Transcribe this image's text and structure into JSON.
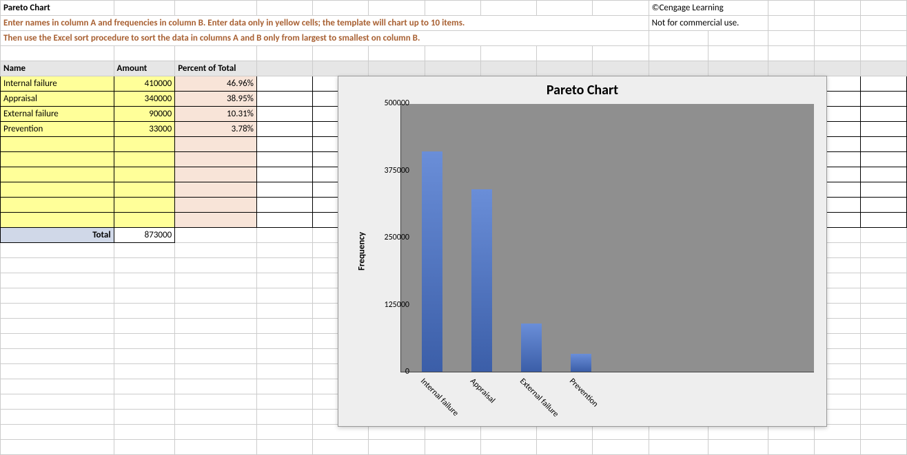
{
  "header": {
    "title": "Pareto Chart",
    "copyright": "©Cengage Learning",
    "notice": "Not for commercial use."
  },
  "instructions": {
    "line1": "Enter names in column A and frequencies in column B.  Enter data only in yellow cells; the template will chart up to 10 items.",
    "line2": "Then use the Excel sort procedure to sort the data in columns A and B only from largest to smallest on column B."
  },
  "columns": {
    "name": "Name",
    "amount": "Amount",
    "pct": "Percent of Total"
  },
  "rows": [
    {
      "name": "Internal failure",
      "amount": "410000",
      "pct": "46.96%"
    },
    {
      "name": "Appraisal",
      "amount": "340000",
      "pct": "38.95%"
    },
    {
      "name": "External failure",
      "amount": "90000",
      "pct": "10.31%"
    },
    {
      "name": "Prevention",
      "amount": "33000",
      "pct": "3.78%"
    },
    {
      "name": "",
      "amount": "",
      "pct": ""
    },
    {
      "name": "",
      "amount": "",
      "pct": ""
    },
    {
      "name": "",
      "amount": "",
      "pct": ""
    },
    {
      "name": "",
      "amount": "",
      "pct": ""
    },
    {
      "name": "",
      "amount": "",
      "pct": ""
    },
    {
      "name": "",
      "amount": "",
      "pct": ""
    }
  ],
  "total": {
    "label": "Total",
    "amount": "873000"
  },
  "chart_data": {
    "type": "bar",
    "title": "Pareto Chart",
    "ylabel": "Frequency",
    "xlabel": "",
    "categories": [
      "Internal failure",
      "Appraisal",
      "External failure",
      "Prevention"
    ],
    "values": [
      410000,
      340000,
      90000,
      33000
    ],
    "ylim": [
      0,
      500000
    ],
    "yticks": [
      0,
      125000,
      250000,
      375000,
      500000
    ]
  }
}
